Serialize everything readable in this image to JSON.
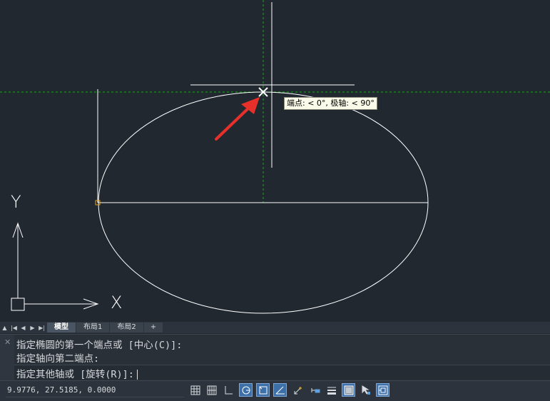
{
  "canvas": {
    "tooltip": "端点: < 0°, 极轴: < 90°",
    "ucs_y_label": "Y",
    "ucs_x_label": "X"
  },
  "layout_tabs": {
    "tabs": [
      {
        "label": "模型",
        "active": true
      },
      {
        "label": "布局1",
        "active": false
      },
      {
        "label": "布局2",
        "active": false
      }
    ],
    "add_label": "+"
  },
  "command_line": {
    "close_icon": "close-icon",
    "history": [
      "指定椭圆的第一个端点或 [中心(C)]:",
      "指定轴向第二端点:"
    ],
    "prompt": "指定其他轴或 [旋转(R)]:"
  },
  "status_bar": {
    "coordinates": "9.9776, 27.5185, 0.0000",
    "toggles": [
      {
        "name": "grid-display",
        "on": false
      },
      {
        "name": "snap-mode",
        "on": false
      },
      {
        "name": "ortho-mode",
        "on": false
      },
      {
        "name": "polar-tracking",
        "on": true
      },
      {
        "name": "object-snap",
        "on": true
      },
      {
        "name": "object-snap-tracking",
        "on": true
      },
      {
        "name": "dynamic-ucs",
        "on": false
      },
      {
        "name": "dynamic-input",
        "on": false
      },
      {
        "name": "lineweight",
        "on": false
      },
      {
        "name": "transparency",
        "on": true
      },
      {
        "name": "selection-cycling",
        "on": false
      },
      {
        "name": "annotation-monitor",
        "on": true
      }
    ]
  },
  "colors": {
    "canvas_bg": "#212830",
    "geometry": "#ffffff",
    "tracking_line": "#1ea81e",
    "arrow": "#e8302a",
    "toggle_on": "#3d6fa8"
  }
}
